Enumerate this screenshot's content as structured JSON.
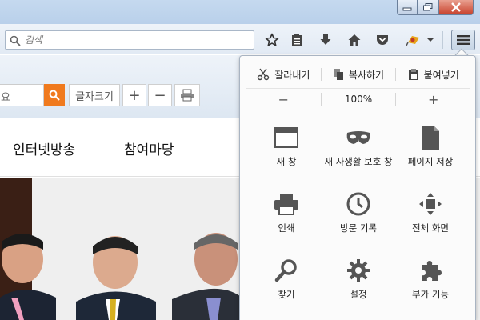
{
  "toolbar": {
    "search_placeholder": "검색"
  },
  "page": {
    "search_text": "요",
    "font_size_label": "글자크기",
    "font_plus": "+",
    "font_minus": "−",
    "nav_items": [
      "인터넷방송",
      "참여마당"
    ],
    "accent_color": "#f07a1e"
  },
  "menu": {
    "edit": {
      "cut": "잘라내기",
      "copy": "복사하기",
      "paste": "붙여넣기"
    },
    "zoom": {
      "out": "−",
      "level": "100%",
      "in": "+"
    },
    "items": [
      {
        "label": "새 창",
        "icon": "new-window-icon"
      },
      {
        "label": "새 사생활 보호 창",
        "icon": "private-mask-icon"
      },
      {
        "label": "페이지 저장",
        "icon": "save-page-icon"
      },
      {
        "label": "인쇄",
        "icon": "printer-icon"
      },
      {
        "label": "방문 기록",
        "icon": "history-clock-icon"
      },
      {
        "label": "전체 화면",
        "icon": "fullscreen-icon"
      },
      {
        "label": "찾기",
        "icon": "find-icon"
      },
      {
        "label": "설정",
        "icon": "settings-gear-icon"
      },
      {
        "label": "부가 기능",
        "icon": "addons-puzzle-icon"
      }
    ]
  }
}
